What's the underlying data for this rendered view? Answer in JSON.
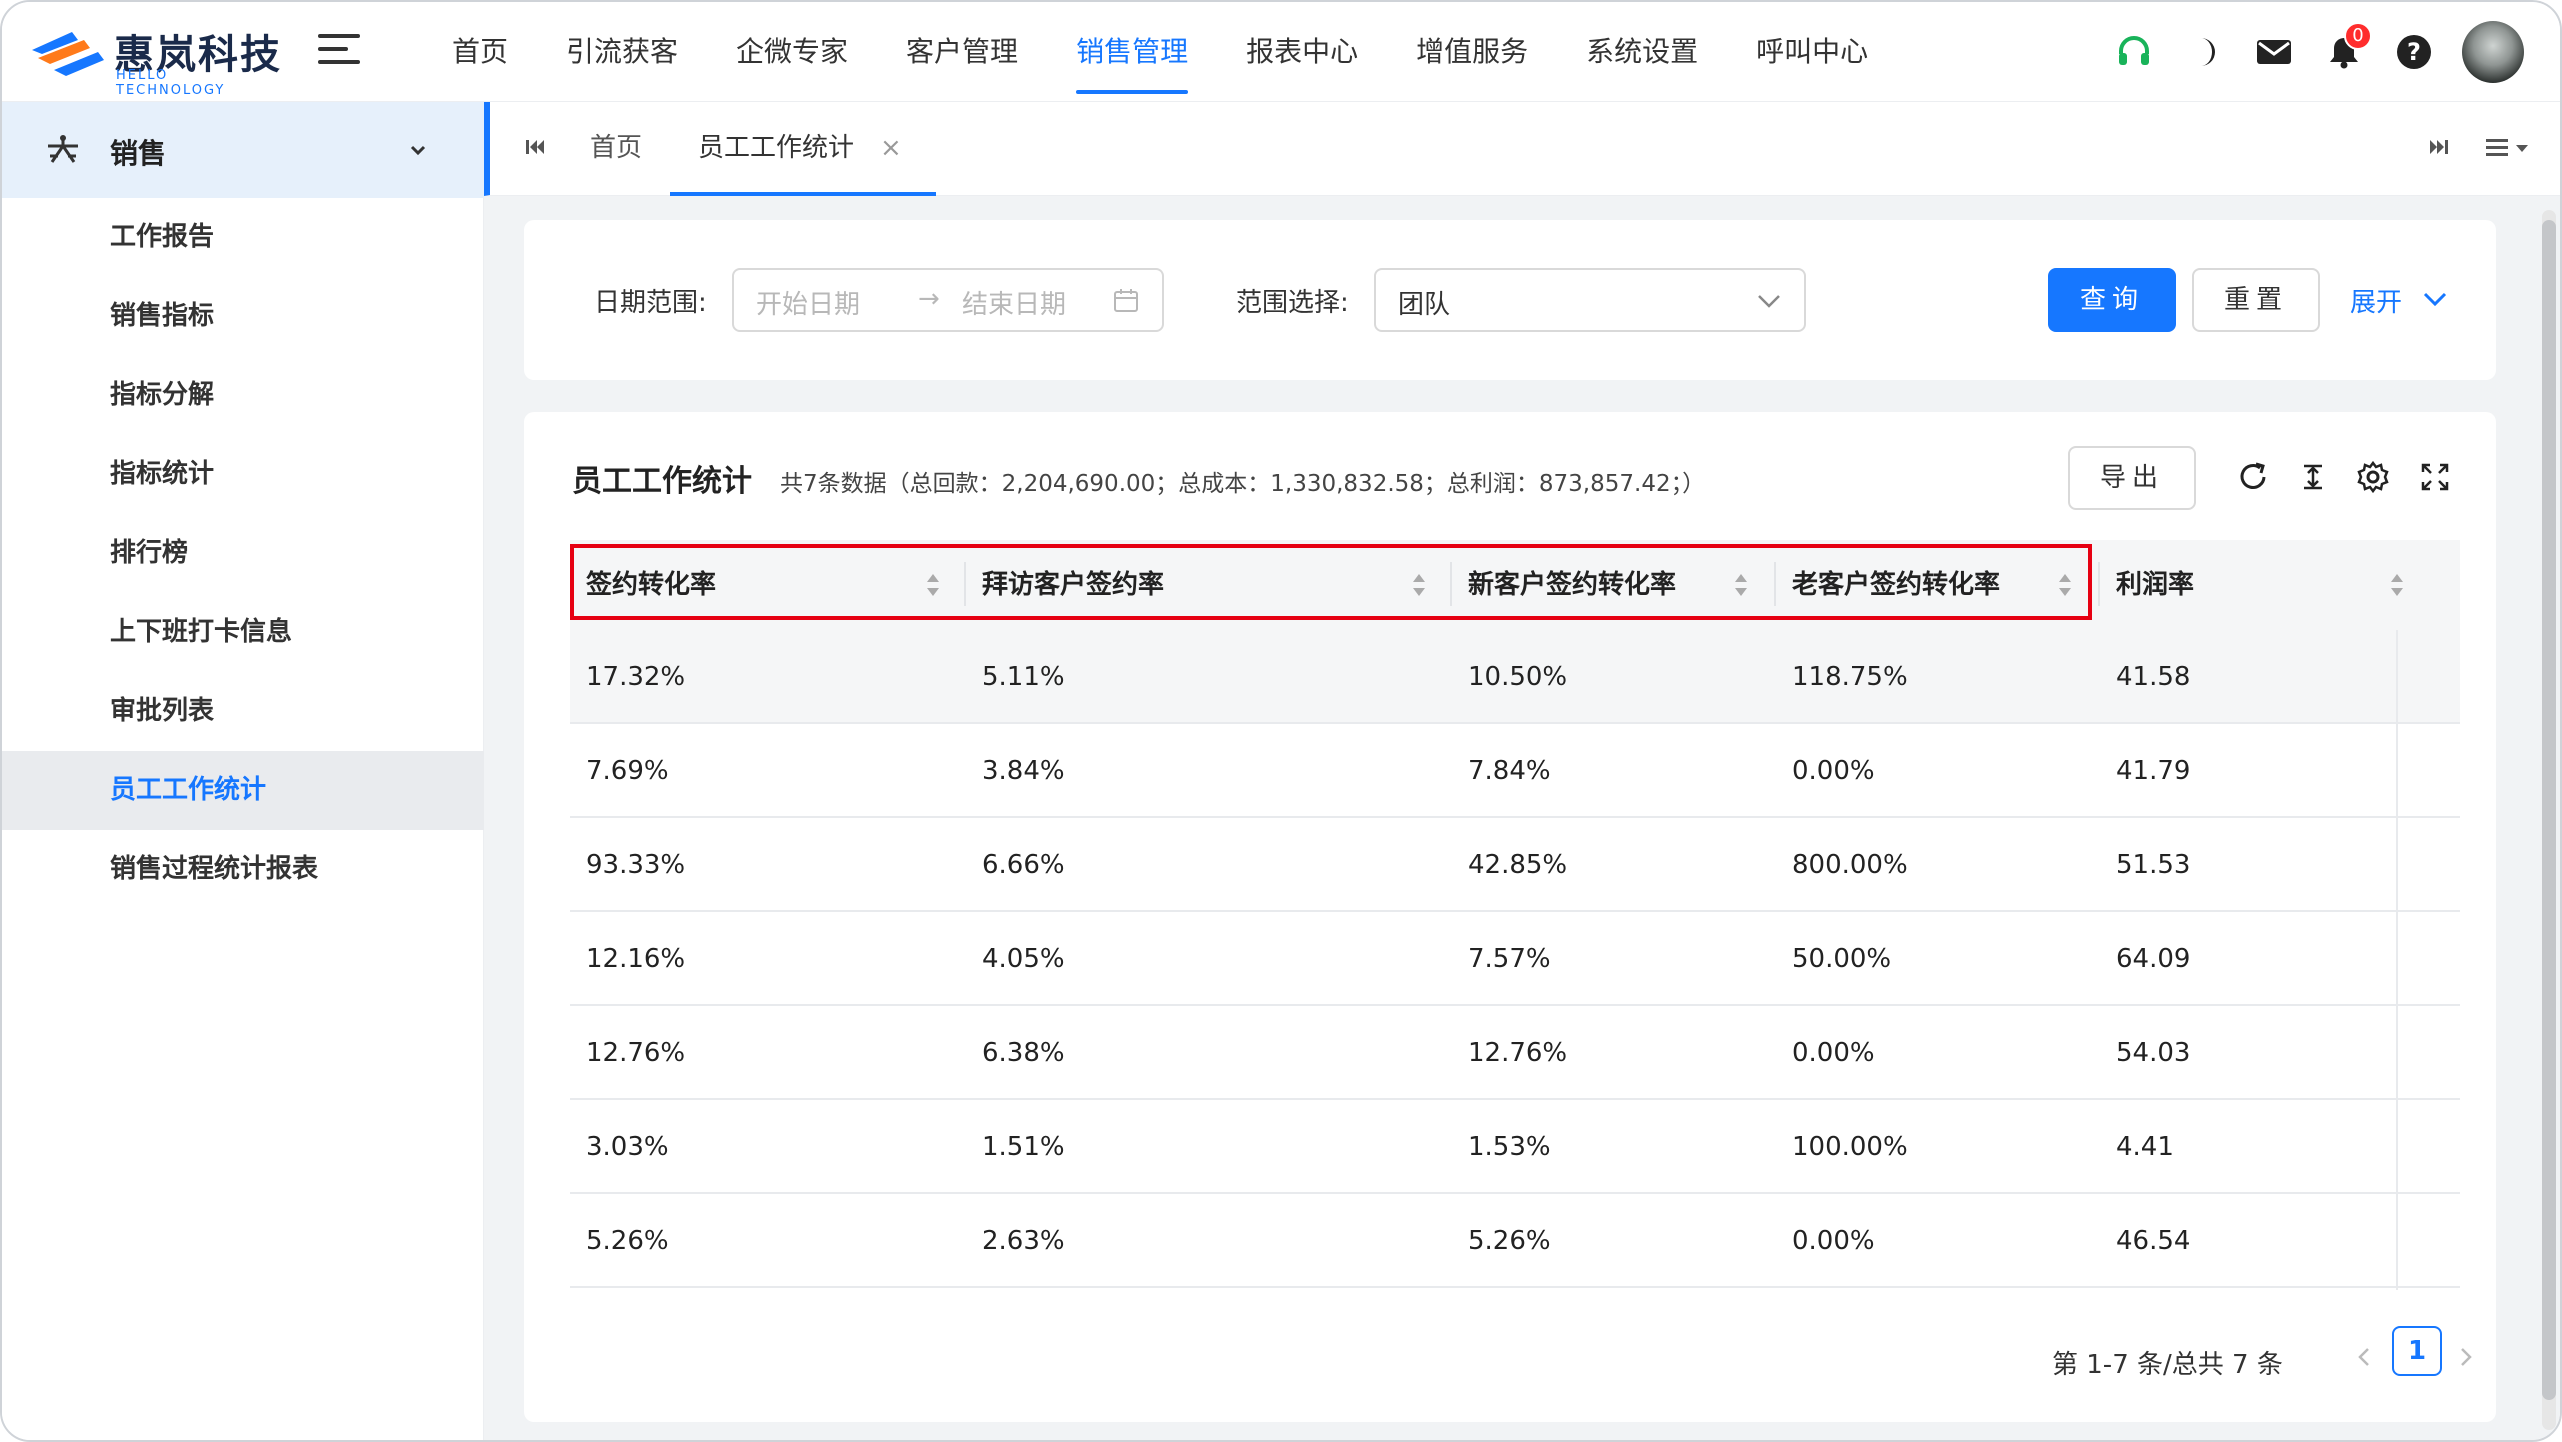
{
  "brand": {
    "title": "惠岚科技",
    "subtitle": "HELLO TECHNOLOGY"
  },
  "nav": [
    "首页",
    "引流获客",
    "企微专家",
    "客户管理",
    "销售管理",
    "报表中心",
    "增值服务",
    "系统设置",
    "呼叫中心"
  ],
  "nav_active_index": 4,
  "header": {
    "notification_count": "0"
  },
  "sidebar": {
    "section": "销售",
    "items": [
      "工作报告",
      "销售指标",
      "指标分解",
      "指标统计",
      "排行榜",
      "上下班打卡信息",
      "审批列表",
      "员工工作统计",
      "销售过程统计报表"
    ],
    "active_index": 7
  },
  "tabs": {
    "home": "首页",
    "active": "员工工作统计",
    "close": "×"
  },
  "filter": {
    "date_label": "日期范围:",
    "start_placeholder": "开始日期",
    "arrow": "→",
    "end_placeholder": "结束日期",
    "scope_label": "范围选择:",
    "scope_value": "团队",
    "query": "查询",
    "reset": "重置",
    "expand": "展开"
  },
  "table_card": {
    "title": "员工工作统计",
    "summary": "共7条数据（总回款：2,204,690.00；总成本：1,330,832.58；总利润：873,857.42；）",
    "export": "导出"
  },
  "columns": [
    "签约转化率",
    "拜访客户签约率",
    "新客户签约转化率",
    "老客户签约转化率",
    "利润率"
  ],
  "rows": [
    [
      "17.32%",
      "5.11%",
      "10.50%",
      "118.75%",
      "41.58"
    ],
    [
      "7.69%",
      "3.84%",
      "7.84%",
      "0.00%",
      "41.79"
    ],
    [
      "93.33%",
      "6.66%",
      "42.85%",
      "800.00%",
      "51.53"
    ],
    [
      "12.16%",
      "4.05%",
      "7.57%",
      "50.00%",
      "64.09"
    ],
    [
      "12.76%",
      "6.38%",
      "12.76%",
      "0.00%",
      "54.03"
    ],
    [
      "3.03%",
      "1.51%",
      "1.53%",
      "100.00%",
      "4.41"
    ],
    [
      "5.26%",
      "2.63%",
      "5.26%",
      "0.00%",
      "46.54"
    ]
  ],
  "pagination": {
    "summary": "第 1-7 条/总共 7 条",
    "current": "1"
  },
  "colors": {
    "primary": "#1677ff",
    "highlight": "#e60012",
    "headset": "#19b35a",
    "badge": "#ff2d2d"
  }
}
